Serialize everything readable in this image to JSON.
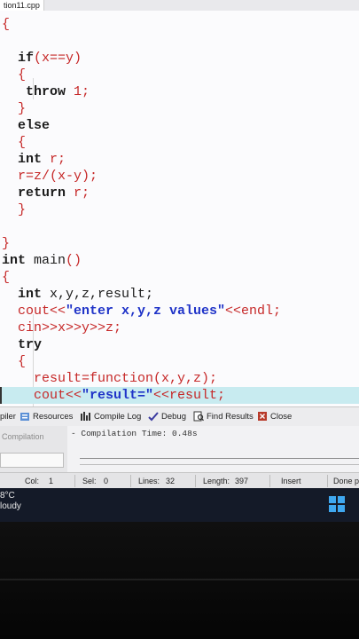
{
  "window": {
    "tab_title": "tion11.cpp"
  },
  "editor": {
    "lines": [
      [
        {
          "t": "{",
          "c": "rd"
        }
      ],
      [],
      [
        {
          "t": "  if",
          "c": "kw"
        },
        {
          "t": "(x==y)",
          "c": "rd"
        }
      ],
      [
        {
          "t": "  {",
          "c": "rd"
        }
      ],
      [
        {
          "t": "   throw ",
          "c": "kw"
        },
        {
          "t": "1;",
          "c": "rd"
        }
      ],
      [
        {
          "t": "  }",
          "c": "rd"
        }
      ],
      [
        {
          "t": "  else",
          "c": "kw"
        }
      ],
      [
        {
          "t": "  {",
          "c": "rd"
        }
      ],
      [
        {
          "t": "  int ",
          "c": "kw"
        },
        {
          "t": "r;",
          "c": "rd"
        }
      ],
      [
        {
          "t": "  r=z/(x-y);",
          "c": "rd"
        }
      ],
      [
        {
          "t": "  return ",
          "c": "kw"
        },
        {
          "t": "r;",
          "c": "rd"
        }
      ],
      [
        {
          "t": "  }",
          "c": "rd"
        }
      ],
      [],
      [
        {
          "t": "}",
          "c": "rd"
        }
      ],
      [
        {
          "t": "int ",
          "c": "kw"
        },
        {
          "t": "main",
          "c": "tx"
        },
        {
          "t": "()",
          "c": "rd"
        }
      ],
      [
        {
          "t": "{",
          "c": "rd"
        }
      ],
      [
        {
          "t": "  int ",
          "c": "kw"
        },
        {
          "t": "x,y,z,result;",
          "c": "tx"
        }
      ],
      [
        {
          "t": "  cout<<",
          "c": "rd"
        },
        {
          "t": "\"enter x,y,z values\"",
          "c": "bl"
        },
        {
          "t": "<<endl;",
          "c": "rd"
        }
      ],
      [
        {
          "t": "  cin>>x>>y>>z;",
          "c": "rd"
        }
      ],
      [
        {
          "t": "  try",
          "c": "kw"
        }
      ],
      [
        {
          "t": "  {",
          "c": "rd"
        }
      ],
      [
        {
          "t": "    result=function(x,y,z);",
          "c": "rd"
        }
      ],
      [
        {
          "t": "    cout<<",
          "c": "rd"
        },
        {
          "t": "\"result=\"",
          "c": "bl"
        },
        {
          "t": "<<result;",
          "c": "rd"
        }
      ]
    ],
    "highlight_line": 22
  },
  "panel": {
    "tabs": [
      "piler",
      "Resources",
      "Compile Log",
      "Debug",
      "Find Results",
      "Close"
    ],
    "compile_button": "Compilation",
    "log_text": "- Compilation Time: 0.48s"
  },
  "status": {
    "col_label": "Col:",
    "col_value": "1",
    "sel_label": "Sel:",
    "sel_value": "0",
    "lines_label": "Lines:",
    "lines_value": "32",
    "length_label": "Length:",
    "length_value": "397",
    "mode": "Insert",
    "state": "Done p"
  },
  "taskbar": {
    "temperature": "8°C",
    "weather": "loudy"
  },
  "colors": {
    "keyword": "#1c1c1c",
    "operator": "#c62828",
    "string": "#1f33c8",
    "highlight": "#c8ebf0",
    "taskbar": "#141a28"
  },
  "icons": [
    "resources-icon",
    "compile-log-icon",
    "debug-check-icon",
    "find-results-icon",
    "close-icon",
    "windows-start-icon"
  ]
}
